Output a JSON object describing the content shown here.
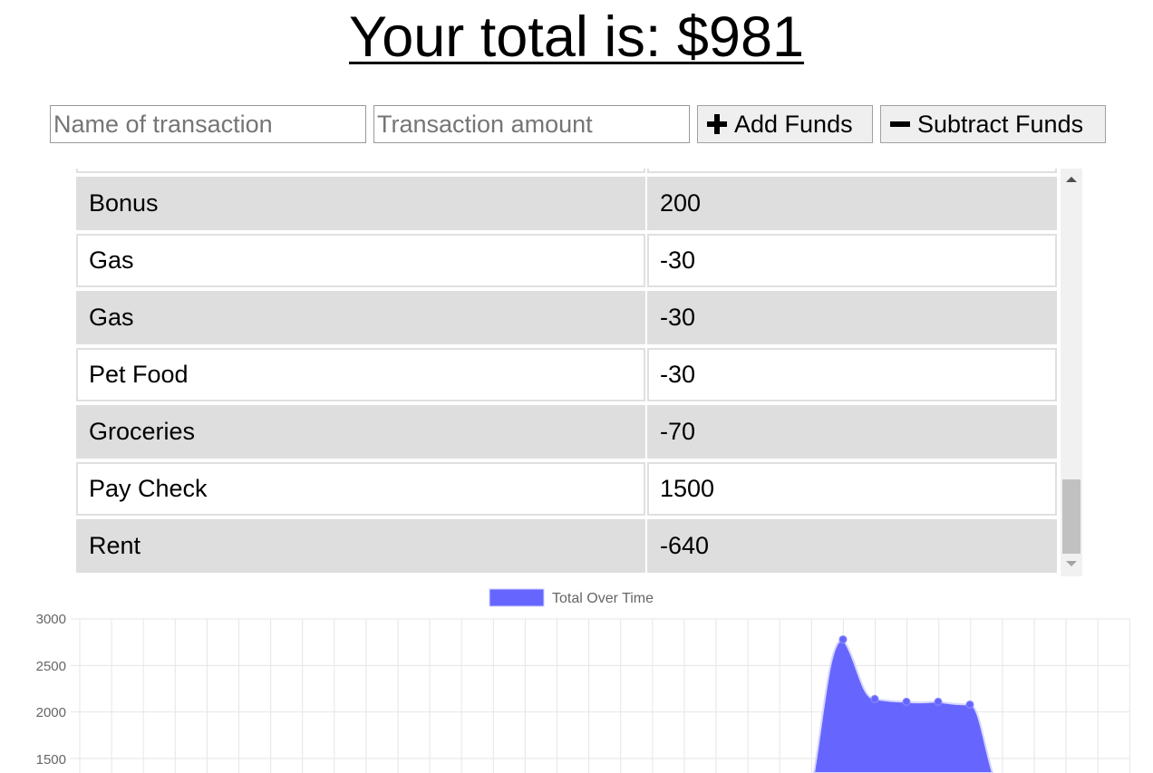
{
  "header": {
    "title": "Your total is: $981"
  },
  "form": {
    "name_placeholder": "Name of transaction",
    "amount_placeholder": "Transaction amount",
    "add_label": "Add Funds",
    "subtract_label": "Subtract Funds"
  },
  "transactions": [
    {
      "name": "",
      "value": ""
    },
    {
      "name": "Bonus",
      "value": "200"
    },
    {
      "name": "Gas",
      "value": "-30"
    },
    {
      "name": "Gas",
      "value": "-30"
    },
    {
      "name": "Pet Food",
      "value": "-30"
    },
    {
      "name": "Groceries",
      "value": "-70"
    },
    {
      "name": "Pay Check",
      "value": "1500"
    },
    {
      "name": "Rent",
      "value": "-640"
    }
  ],
  "chart_data": {
    "type": "area",
    "legend": [
      "Total Over Time"
    ],
    "legend_position": "top",
    "series": [
      {
        "name": "Total Over Time",
        "color": "#6666ff",
        "values": [
          2780,
          2140,
          2110,
          2110,
          2080,
          1400
        ]
      }
    ],
    "ylim": [
      1500,
      3000
    ],
    "yticks": [
      "3000",
      "2500",
      "2000",
      "1500"
    ],
    "grid": true
  }
}
